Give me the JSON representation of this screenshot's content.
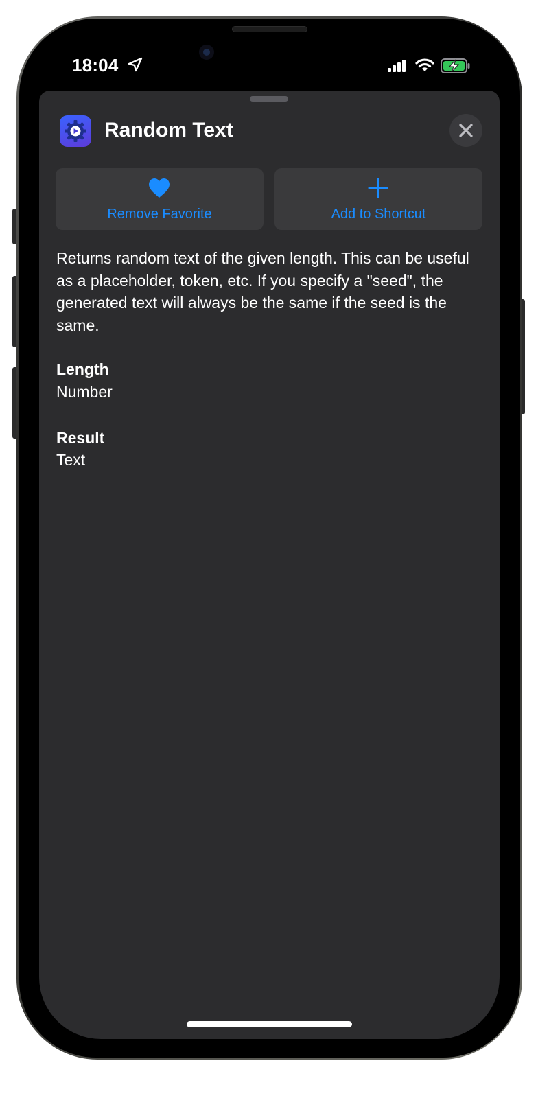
{
  "status_bar": {
    "time": "18:04",
    "location_icon": "location-arrow-icon",
    "signal_icon": "cellular-signal-icon",
    "wifi_icon": "wifi-icon",
    "battery_icon": "battery-charging-icon"
  },
  "sheet": {
    "app_icon": "gear-play-icon",
    "title": "Random Text",
    "close_icon": "close-icon",
    "buttons": {
      "favorite_label": "Remove Favorite",
      "favorite_icon": "heart-icon",
      "add_label": "Add to Shortcut",
      "add_icon": "plus-icon"
    },
    "description": "Returns random text of the given length. This can be useful as a placeholder, token, etc. If you specify a \"seed\", the generated text will always be the same if the seed is the same.",
    "params": [
      {
        "label": "Length",
        "value": "Number"
      },
      {
        "label": "Result",
        "value": "Text"
      }
    ]
  },
  "colors": {
    "accent": "#1a8cff",
    "sheet_background": "#2c2c2e",
    "button_background": "#3a3a3c",
    "battery_charging": "#34c759"
  }
}
